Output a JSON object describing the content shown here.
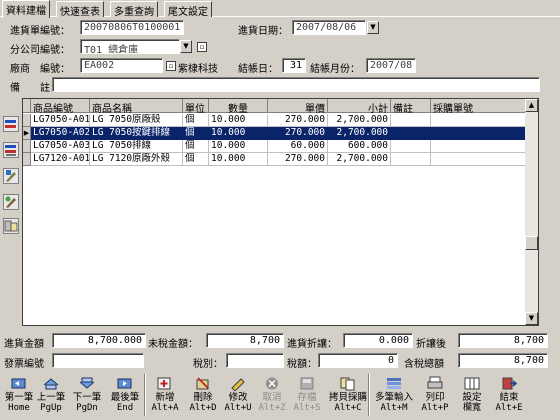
{
  "tabs": [
    "資料建檔",
    "快速查表",
    "多重查詢",
    "尾文設定"
  ],
  "header": {
    "order_no_label": "進貨單編號：",
    "order_no": "20070806T0100001",
    "date_label": "進貨日期：",
    "date": "2007/08/06",
    "branch_label": "分公司編號：",
    "branch": "T01 總倉庫",
    "vendor_label": "廠商　編號：",
    "vendor_code": "EA002",
    "vendor_name": "紫棣科技",
    "close_day_label": "結帳日：",
    "close_day": "31",
    "close_month_label": "結帳月份：",
    "close_month": "2007/08",
    "note_label": "備　　註：",
    "note": ""
  },
  "grid": {
    "columns": [
      "商品編號",
      "商品名稱",
      "單位",
      "數量",
      "單價",
      "小計",
      "備註",
      "採購單號"
    ],
    "rows": [
      [
        "LG7050-A01",
        "LG 7050原廠殼",
        "個",
        "10.000",
        "270.000",
        "2,700.000",
        "",
        ""
      ],
      [
        "LG7050-A02",
        "LG 7050按鍵排線",
        "個",
        "10.000",
        "270.000",
        "2,700.000",
        "",
        ""
      ],
      [
        "LG7050-A03",
        "LG 7050排線",
        "個",
        "10.000",
        "60.000",
        "600.000",
        "",
        ""
      ],
      [
        "LG7120-A01",
        "LG 7120原廠外殼",
        "個",
        "10.000",
        "270.000",
        "2,700.000",
        "",
        ""
      ]
    ],
    "selected_row": 1
  },
  "totals": {
    "amount_label": "進貨金額",
    "amount": "8,700.000",
    "untaxed_label": "未稅金額：",
    "untaxed": "8,700",
    "discount_label": "進貨折讓：",
    "discount": "0.000",
    "after_discount_label": "折讓後",
    "after_discount": "8,700",
    "invoice_label": "發票編號",
    "invoice": "",
    "tax_type_label": "稅別：",
    "tax_type": "",
    "tax_label": "稅額：",
    "tax": "0",
    "total_label": "含稅總額",
    "total": "8,700"
  },
  "toolbar": [
    {
      "l1": "第一筆",
      "l2": "Home",
      "icon": "first-record-icon",
      "enabled": true
    },
    {
      "l1": "上一筆",
      "l2": "PgUp",
      "icon": "prev-record-icon",
      "enabled": true
    },
    {
      "l1": "下一筆",
      "l2": "PgDn",
      "icon": "next-record-icon",
      "enabled": true
    },
    {
      "l1": "最後筆",
      "l2": "End",
      "icon": "last-record-icon",
      "enabled": true
    },
    {
      "l1": "新增",
      "l2": "Alt+A",
      "icon": "add-icon",
      "enabled": true
    },
    {
      "l1": "刪除",
      "l2": "Alt+D",
      "icon": "delete-icon",
      "enabled": true
    },
    {
      "l1": "修改",
      "l2": "Alt+U",
      "icon": "edit-icon",
      "enabled": true
    },
    {
      "l1": "取消",
      "l2": "Alt+Z",
      "icon": "cancel-icon",
      "enabled": false
    },
    {
      "l1": "存檔",
      "l2": "Alt+S",
      "icon": "save-icon",
      "enabled": false
    },
    {
      "l1": "拷貝採購",
      "l2": "Alt+C",
      "icon": "copy-purchase-icon",
      "enabled": true
    },
    {
      "l1": "多筆輸入",
      "l2": "Alt+M",
      "icon": "multi-input-icon",
      "enabled": true
    },
    {
      "l1": "列印",
      "l2": "Alt+P",
      "icon": "print-icon",
      "enabled": true
    },
    {
      "l1": "設定",
      "l2": "欄寬",
      "icon": "column-width-icon",
      "enabled": true
    },
    {
      "l1": "結束",
      "l2": "Alt+E",
      "icon": "exit-icon",
      "enabled": true
    }
  ],
  "colors": {
    "face": "#d4d0c8",
    "selection": "#0a246a"
  }
}
